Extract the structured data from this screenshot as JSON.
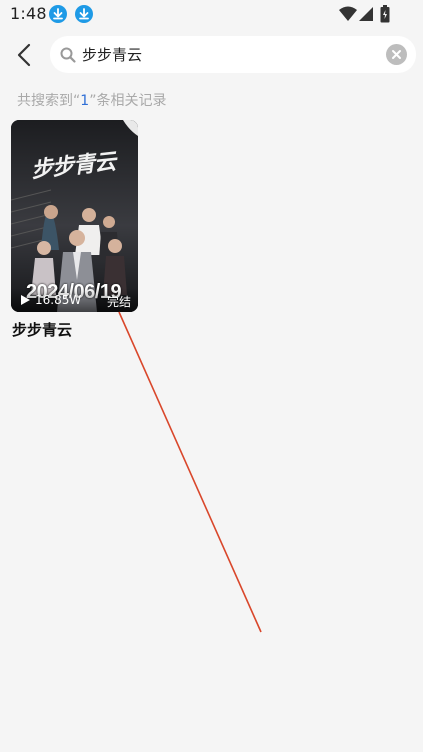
{
  "status_bar": {
    "time": "1:48",
    "icons": [
      "download-icon",
      "download-icon",
      "wifi-icon",
      "signal-icon",
      "battery-icon"
    ]
  },
  "search": {
    "back_icon": "chevron-left-icon",
    "search_icon": "magnifier-icon",
    "query": "步步青云",
    "clear_icon": "close-circle-icon"
  },
  "results_summary": {
    "prefix": "共搜索到“",
    "count": "1",
    "suffix": "”条相关记录"
  },
  "results": [
    {
      "title": "步步青云",
      "poster_title": "步步青云",
      "poster_date": "2024/06/19",
      "views": "16.85W",
      "status": "完结",
      "play_icon": "play-icon"
    }
  ],
  "colors": {
    "background": "#f5f5f5",
    "accent_blue": "#2f6fd6",
    "download_icon": "#1e9ae6",
    "annotation_line": "#d9472b"
  }
}
